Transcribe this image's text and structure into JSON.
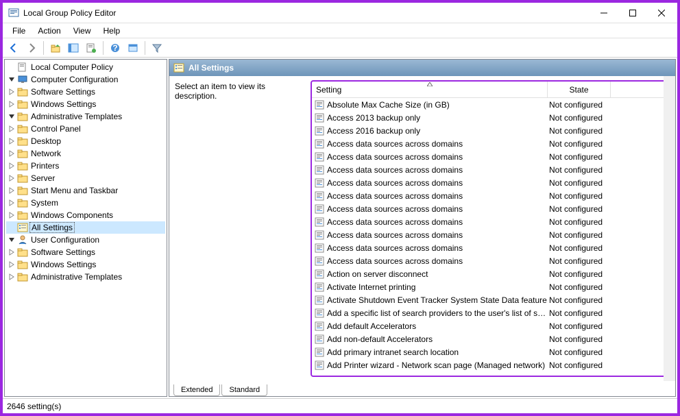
{
  "window": {
    "title": "Local Group Policy Editor"
  },
  "menubar": [
    "File",
    "Action",
    "View",
    "Help"
  ],
  "tree": {
    "root": "Local Computer Policy",
    "computer_config": "Computer Configuration",
    "computer_children": [
      "Software Settings",
      "Windows Settings",
      "Administrative Templates"
    ],
    "admin_children": [
      "Control Panel",
      "Desktop",
      "Network",
      "Printers",
      "Server",
      "Start Menu and Taskbar",
      "System",
      "Windows Components",
      "All Settings"
    ],
    "user_config": "User Configuration",
    "user_children": [
      "Software Settings",
      "Windows Settings",
      "Administrative Templates"
    ]
  },
  "pane_header": "All Settings",
  "description_prompt": "Select an item to view its description.",
  "columns": {
    "setting": "Setting",
    "state": "State"
  },
  "settings": [
    {
      "name": "Absolute Max Cache Size (in GB)",
      "state": "Not configured"
    },
    {
      "name": "Access 2013 backup only",
      "state": "Not configured"
    },
    {
      "name": "Access 2016 backup only",
      "state": "Not configured"
    },
    {
      "name": "Access data sources across domains",
      "state": "Not configured"
    },
    {
      "name": "Access data sources across domains",
      "state": "Not configured"
    },
    {
      "name": "Access data sources across domains",
      "state": "Not configured"
    },
    {
      "name": "Access data sources across domains",
      "state": "Not configured"
    },
    {
      "name": "Access data sources across domains",
      "state": "Not configured"
    },
    {
      "name": "Access data sources across domains",
      "state": "Not configured"
    },
    {
      "name": "Access data sources across domains",
      "state": "Not configured"
    },
    {
      "name": "Access data sources across domains",
      "state": "Not configured"
    },
    {
      "name": "Access data sources across domains",
      "state": "Not configured"
    },
    {
      "name": "Access data sources across domains",
      "state": "Not configured"
    },
    {
      "name": "Action on server disconnect",
      "state": "Not configured"
    },
    {
      "name": "Activate Internet printing",
      "state": "Not configured"
    },
    {
      "name": "Activate Shutdown Event Tracker System State Data feature",
      "state": "Not configured"
    },
    {
      "name": "Add a specific list of search providers to the user's list of sea...",
      "state": "Not configured"
    },
    {
      "name": "Add default Accelerators",
      "state": "Not configured"
    },
    {
      "name": "Add non-default Accelerators",
      "state": "Not configured"
    },
    {
      "name": "Add primary intranet search location",
      "state": "Not configured"
    },
    {
      "name": "Add Printer wizard - Network scan page (Managed network)",
      "state": "Not configured"
    }
  ],
  "tabs": {
    "extended": "Extended",
    "standard": "Standard"
  },
  "statusbar": "2646 setting(s)"
}
